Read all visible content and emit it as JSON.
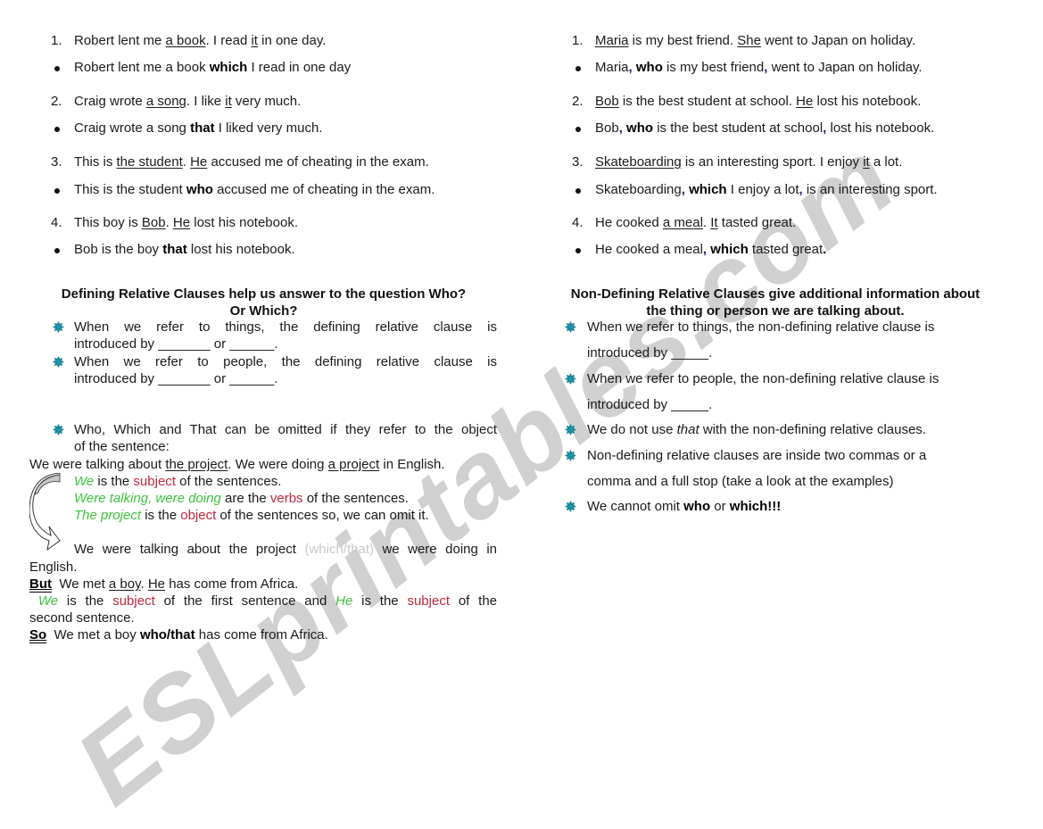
{
  "watermark": "ESLprintables.com",
  "left": {
    "examples": [
      {
        "marker": "1.",
        "type": "numbered",
        "parts": [
          [
            "Robert lent me ",
            ""
          ],
          [
            "a book",
            "u"
          ],
          [
            ". I read ",
            ""
          ],
          [
            "it",
            "u"
          ],
          [
            " in one day.",
            ""
          ]
        ]
      },
      {
        "marker": "•",
        "type": "bullet",
        "parts": [
          [
            "Robert lent me a book ",
            ""
          ],
          [
            "which",
            "b"
          ],
          [
            " I read in one day",
            ""
          ]
        ]
      },
      {
        "marker": "2.",
        "type": "numbered",
        "parts": [
          [
            "Craig wrote ",
            ""
          ],
          [
            "a song",
            "u"
          ],
          [
            ". I like ",
            ""
          ],
          [
            "it",
            "u"
          ],
          [
            " very much.",
            ""
          ]
        ]
      },
      {
        "marker": "•",
        "type": "bullet",
        "parts": [
          [
            "Craig wrote a song ",
            ""
          ],
          [
            "that",
            "b"
          ],
          [
            " I liked very much.",
            ""
          ]
        ]
      },
      {
        "marker": "3.",
        "type": "numbered",
        "parts": [
          [
            "This is ",
            ""
          ],
          [
            "the student",
            "u"
          ],
          [
            ". ",
            ""
          ],
          [
            "He",
            "u"
          ],
          [
            " accused me of cheating in the exam.",
            ""
          ]
        ]
      },
      {
        "marker": "•",
        "type": "bullet",
        "parts": [
          [
            "This is the student ",
            ""
          ],
          [
            "who",
            "b"
          ],
          [
            " accused me of cheating in the exam.",
            ""
          ]
        ]
      },
      {
        "marker": "4.",
        "type": "numbered",
        "parts": [
          [
            "This boy is ",
            ""
          ],
          [
            "Bob",
            "u"
          ],
          [
            ". ",
            ""
          ],
          [
            "He",
            "u"
          ],
          [
            " lost his notebook.",
            ""
          ]
        ]
      },
      {
        "marker": "•",
        "type": "bullet",
        "parts": [
          [
            "Bob is the boy ",
            ""
          ],
          [
            "that",
            "b"
          ],
          [
            " lost his notebook.",
            ""
          ]
        ]
      }
    ],
    "heading_line1": "Defining Relative Clauses help us answer to the question Who?",
    "heading_line2": "Or Which?",
    "rules": [
      {
        "line1": "When we refer to things, the defining relative clause is",
        "line2": "introduced by _______ or ______."
      },
      {
        "line1": "When we refer to people, the defining relative clause is",
        "line2": "introduced by _______ or ______."
      },
      {
        "line1": "Who, Which and That can be omitted if they refer to the object",
        "line2": "of the sentence:"
      }
    ],
    "sentence": [
      [
        "We were talking about ",
        ""
      ],
      [
        "the project",
        "u"
      ],
      [
        ". We were doing ",
        ""
      ],
      [
        "a project",
        "u"
      ],
      [
        " in English.",
        ""
      ]
    ],
    "explain": [
      [
        [
          "We",
          "green"
        ],
        [
          " is the ",
          ""
        ],
        [
          "subject",
          "red"
        ],
        [
          " of the sentences.",
          ""
        ]
      ],
      [
        [
          "Were talking, were doing",
          "green"
        ],
        [
          " are the ",
          ""
        ],
        [
          "verbs",
          "red"
        ],
        [
          " of the sentences.",
          ""
        ]
      ],
      [
        [
          "The project",
          "green"
        ],
        [
          " is the ",
          ""
        ],
        [
          "object",
          "red"
        ],
        [
          " of the sentences so, we can omit it.",
          ""
        ]
      ]
    ],
    "combined_line1": [
      [
        "We were talking about the project ",
        ""
      ],
      [
        "(which/that)",
        "faint"
      ],
      [
        " we were doing in",
        ""
      ]
    ],
    "combined_line2": "English.",
    "but_label": "But",
    "but_sentence": [
      [
        "  We met ",
        ""
      ],
      [
        "a boy",
        "u"
      ],
      [
        ". ",
        ""
      ],
      [
        "He",
        "u"
      ],
      [
        " has come from Africa.",
        ""
      ]
    ],
    "subject_line1": [
      [
        " We",
        "green"
      ],
      [
        " is the ",
        ""
      ],
      [
        "subject",
        "red"
      ],
      [
        " of the first sentence and ",
        ""
      ],
      [
        "He",
        "green"
      ],
      [
        " is the ",
        ""
      ],
      [
        "subject",
        "red"
      ],
      [
        " of the",
        ""
      ]
    ],
    "subject_line2": "second sentence.",
    "so_label": "So",
    "so_sentence": [
      [
        "  We met a boy ",
        ""
      ],
      [
        "who/that",
        "b"
      ],
      [
        " has come from Africa.",
        ""
      ]
    ]
  },
  "right": {
    "examples": [
      {
        "marker": "1.",
        "type": "numbered",
        "parts": [
          [
            "Maria",
            "u"
          ],
          [
            " is my best friend. ",
            ""
          ],
          [
            "She",
            "u"
          ],
          [
            " went to Japan on holiday.",
            ""
          ]
        ]
      },
      {
        "marker": "•",
        "type": "bullet",
        "parts": [
          [
            "Maria",
            ""
          ],
          [
            ",",
            "comma"
          ],
          [
            " ",
            ""
          ],
          [
            "who",
            "b"
          ],
          [
            " is my best friend",
            ""
          ],
          [
            ",",
            "comma"
          ],
          [
            " went to Japan on holiday.",
            ""
          ]
        ]
      },
      {
        "marker": "2.",
        "type": "numbered",
        "parts": [
          [
            "Bob",
            "u"
          ],
          [
            " is the best student at school. ",
            ""
          ],
          [
            "He",
            "u"
          ],
          [
            " lost his notebook.",
            ""
          ]
        ]
      },
      {
        "marker": "•",
        "type": "bullet",
        "parts": [
          [
            "Bob",
            ""
          ],
          [
            ",",
            "comma"
          ],
          [
            " ",
            ""
          ],
          [
            "who",
            "b"
          ],
          [
            " is the best student at school",
            ""
          ],
          [
            ",",
            "comma"
          ],
          [
            " lost his notebook.",
            ""
          ]
        ]
      },
      {
        "marker": "3.",
        "type": "numbered",
        "parts": [
          [
            "Skateboarding",
            "u"
          ],
          [
            " is an interesting sport. I enjoy ",
            ""
          ],
          [
            "it",
            "u"
          ],
          [
            " a lot.",
            ""
          ]
        ]
      },
      {
        "marker": "•",
        "type": "bullet",
        "parts": [
          [
            "Skateboarding",
            ""
          ],
          [
            ",",
            "comma"
          ],
          [
            " ",
            ""
          ],
          [
            "which",
            "b"
          ],
          [
            " I enjoy a lot",
            ""
          ],
          [
            ",",
            "comma"
          ],
          [
            " is an interesting sport.",
            ""
          ]
        ]
      },
      {
        "marker": "4.",
        "type": "numbered",
        "parts": [
          [
            "He cooked ",
            ""
          ],
          [
            "a meal",
            "u"
          ],
          [
            ". ",
            ""
          ],
          [
            "It",
            "u"
          ],
          [
            " tasted great.",
            ""
          ]
        ]
      },
      {
        "marker": "•",
        "type": "bullet",
        "parts": [
          [
            "He cooked a meal",
            ""
          ],
          [
            ",",
            "comma"
          ],
          [
            " ",
            ""
          ],
          [
            "which",
            "b"
          ],
          [
            " tasted great",
            ""
          ],
          [
            ".",
            "b"
          ]
        ]
      }
    ],
    "heading_line1": "Non-Defining Relative Clauses give additional information about",
    "heading_line2": "the thing or person we are talking about.",
    "rules": [
      {
        "parts": [
          [
            "When we refer to things, the non-defining relative clause is",
            ""
          ]
        ],
        "line2": "introduced by _____."
      },
      {
        "parts": [
          [
            "When we refer to people, the non-defining relative clause is",
            ""
          ]
        ],
        "line2": "introduced by _____."
      },
      {
        "parts": [
          [
            "We do not use ",
            ""
          ],
          [
            "that",
            "i"
          ],
          [
            " with the non-defining relative clauses.",
            ""
          ]
        ],
        "line2": ""
      },
      {
        "parts": [
          [
            "Non-defining relative clauses are inside two commas or a",
            ""
          ]
        ],
        "line2": "comma and a full stop (take a look at the examples)"
      },
      {
        "parts": [
          [
            "We cannot omit ",
            ""
          ],
          [
            "who",
            "b"
          ],
          [
            " or ",
            ""
          ],
          [
            "which!!!",
            "b"
          ]
        ],
        "line2": ""
      }
    ]
  }
}
